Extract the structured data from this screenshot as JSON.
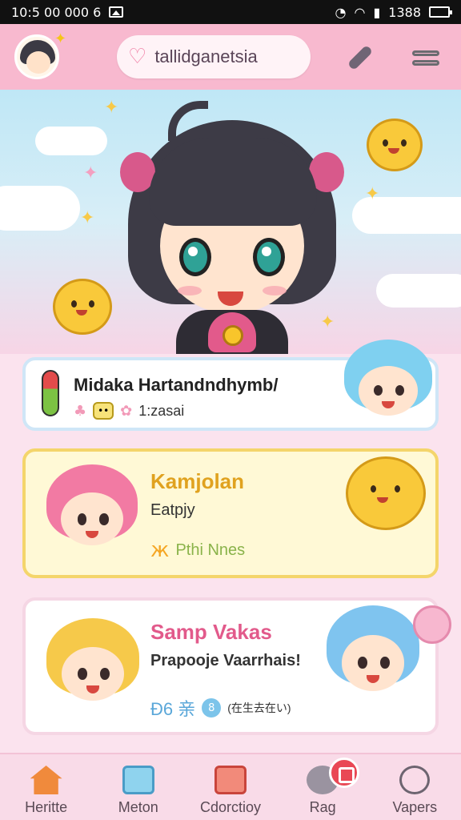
{
  "status_bar": {
    "time": "10:5 00 000 6",
    "battery": "1388"
  },
  "header": {
    "search_text": "tallidganetsia",
    "icons": [
      "avatar",
      "heart-icon",
      "pen-icon",
      "menu-icon"
    ]
  },
  "cards": [
    {
      "title": "Midaka Hartandndhymb/",
      "subtitle": "1:zasai",
      "title_color": "#e25a8b"
    },
    {
      "title": "Kamjolan",
      "subtitle": "Eatpjy",
      "tag": "Pthi Nnes",
      "title_color": "#e0a21f"
    },
    {
      "title": "Samp Vakas",
      "subtitle": "Prapooje Vaarrhais!",
      "tag": "Ð6 亲",
      "note": "(在生去在い)",
      "title_color": "#e25a8b"
    }
  ],
  "bottom_nav": [
    {
      "label": "Heritte",
      "icon": "home-icon"
    },
    {
      "label": "Meton",
      "icon": "map-icon"
    },
    {
      "label": "Cdorctioy",
      "icon": "calendar-icon"
    },
    {
      "label": "Rag",
      "icon": "bag-icon"
    },
    {
      "label": "Vapers",
      "icon": "profile-icon"
    }
  ],
  "colors": {
    "header_bg": "#f8b9cf",
    "nav_bg": "#f9dbe8",
    "accent_pink": "#e25a8b",
    "accent_yellow": "#e0a21f"
  }
}
